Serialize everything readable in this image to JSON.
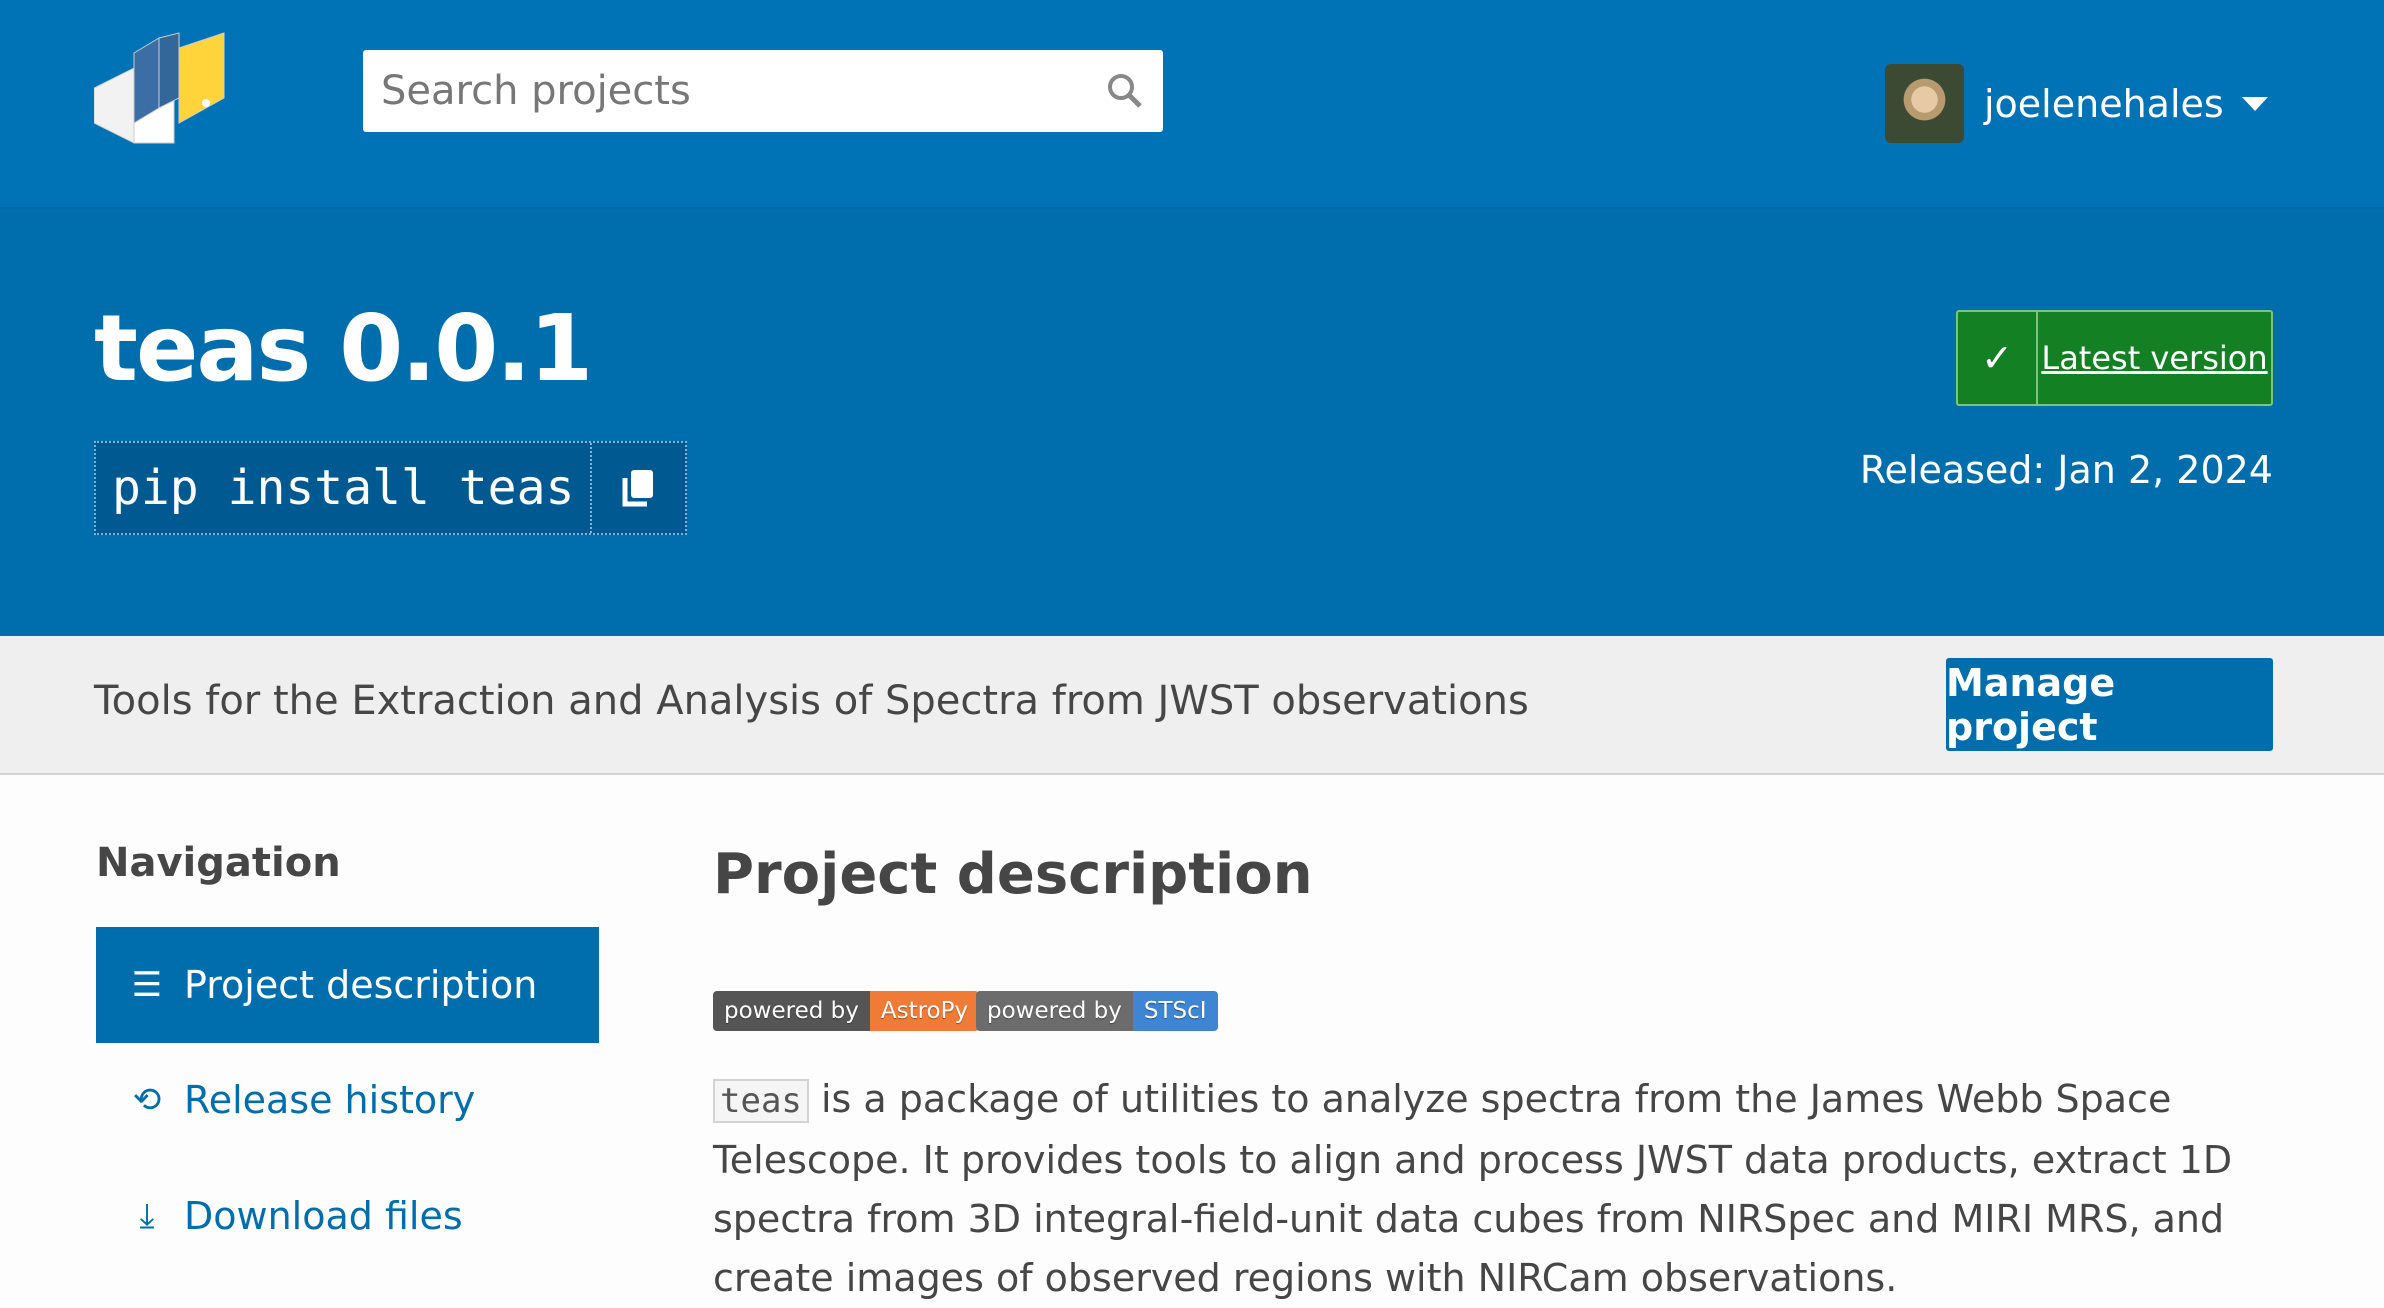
{
  "header": {
    "search_placeholder": "Search projects",
    "username": "joelenehales"
  },
  "hero": {
    "title": "teas 0.0.1",
    "pip_command": "pip install teas",
    "latest_label": "Latest version",
    "released": "Released: Jan 2, 2024"
  },
  "band": {
    "summary": "Tools for the Extraction and Analysis of Spectra from JWST observations",
    "manage_label": "Manage project"
  },
  "nav": {
    "heading": "Navigation",
    "items": [
      {
        "label": "Project description",
        "icon": "list-icon",
        "active": true
      },
      {
        "label": "Release history",
        "icon": "history-icon"
      },
      {
        "label": "Download files",
        "icon": "download-icon"
      }
    ]
  },
  "main": {
    "heading": "Project description",
    "badges": [
      {
        "left": "powered by",
        "right": "AstroPy",
        "color": "#ef7b36"
      },
      {
        "left": "powered by",
        "right": "STScI",
        "color": "#3e86d3"
      }
    ],
    "desc_code": "teas",
    "desc_text": " is a package of utilities to analyze spectra from the James Webb Space Telescope. It provides tools to align and process JWST data products, extract 1D spectra from 3D integral-field-unit data cubes from NIRSpec and MIRI MRS, and create images of observed regions with NIRCam observations."
  },
  "colors": {
    "header": "#0073b7",
    "hero": "#006dad",
    "latest": "#148024"
  }
}
